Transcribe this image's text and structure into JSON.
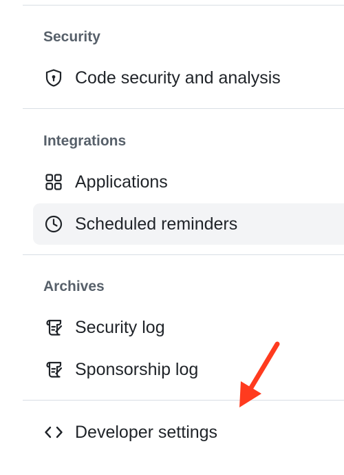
{
  "sections": {
    "security": {
      "heading": "Security",
      "items": [
        {
          "label": "Code security and analysis",
          "icon": "shield-lock-icon"
        }
      ]
    },
    "integrations": {
      "heading": "Integrations",
      "items": [
        {
          "label": "Applications",
          "icon": "apps-grid-icon"
        },
        {
          "label": "Scheduled reminders",
          "icon": "clock-icon",
          "active": true
        }
      ]
    },
    "archives": {
      "heading": "Archives",
      "items": [
        {
          "label": "Security log",
          "icon": "log-icon"
        },
        {
          "label": "Sponsorship log",
          "icon": "log-icon"
        }
      ]
    },
    "developer": {
      "items": [
        {
          "label": "Developer settings",
          "icon": "code-icon"
        }
      ]
    }
  },
  "annotation": {
    "arrow_color": "#ff3b1f",
    "arrow_icon": "red-arrow-annotation"
  },
  "colors": {
    "heading": "#57606a",
    "text": "#1f2328",
    "divider": "#d8dee4",
    "active_background": "#f3f4f6"
  }
}
